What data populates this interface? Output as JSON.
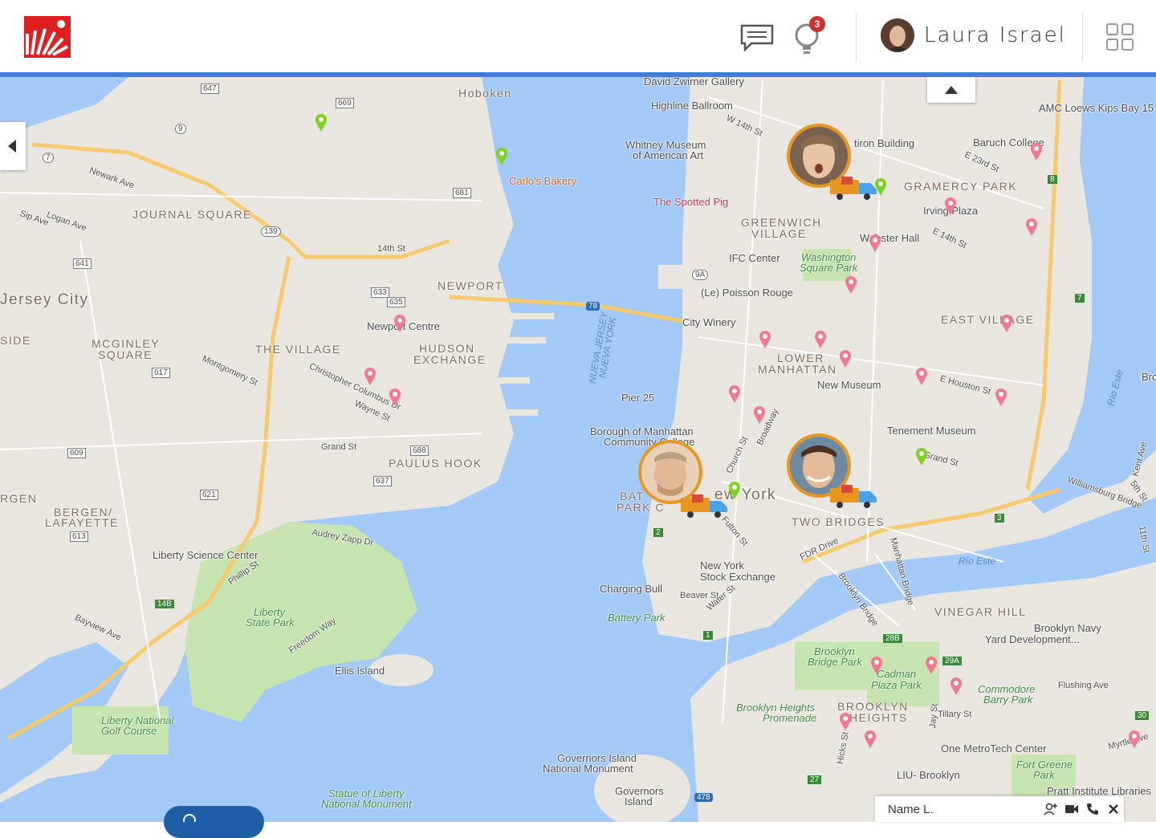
{
  "header": {
    "notifications_count": "3",
    "user_name": "Laura Israel",
    "brand_color": "#e02020",
    "accent_color": "#3f7fd8"
  },
  "map": {
    "neighborhoods": [
      "JOURNAL SQUARE",
      "Jersey City",
      "MCGINLEY",
      "SQUARE",
      "THE VILLAGE",
      "NEWPORT",
      "HUDSON",
      "EXCHANGE",
      "PAULUS HOOK",
      "BERGEN/",
      "LAFAYETTE",
      "GREENWICH",
      "VILLAGE",
      "GRAMERCY PARK",
      "EAST VILLAGE",
      "LOWER",
      "MANHATTAN",
      "TWO BRIDGES",
      "VINEGAR HILL",
      "BROOKLYN",
      "HEIGHTS",
      "SIDE",
      "RGEN",
      "Hoboken",
      "Bro"
    ],
    "places": [
      "David Zwirner Gallery",
      "Highline Ballroom",
      "Whitney Museum",
      "of American Art",
      "Carlo's Bakery",
      "The Spotted Pig",
      "IFC Center",
      "(Le) Poisson Rouge",
      "City Winery",
      "Pier 25",
      "Borough of Manhattan",
      "Community College",
      "New Museum",
      "Tenement Museum",
      "Liberty Science Center",
      "Newport Centre",
      "Ellis Island",
      "Charging Bull",
      "New York",
      "Stock Exchange",
      "Governors Island",
      "National Monument",
      "Governors",
      "Island",
      "One MetroTech Center",
      "LIU- Brooklyn",
      "Pratt Institute Libraries",
      "Brooklyn Navy",
      "Yard Development...",
      "Baruch College",
      "AMC Loews Kips Bay 15",
      "tiron Building",
      "Irving Plaza",
      "Webster Hall",
      "BAT",
      "PARK C",
      "ew York"
    ],
    "parks": [
      "Liberty",
      "State Park",
      "Liberty National",
      "Golf Course",
      "Washington",
      "Square Park",
      "Battery Park",
      "Statue of Liberty",
      "National Monument",
      "Brooklyn",
      "Bridge Park",
      "Cadman",
      "Plaza Park",
      "Brooklyn Heights",
      "Promenade",
      "Commodore",
      "Barry Park",
      "Fort Greene",
      "Park"
    ],
    "water": [
      "Río Este",
      "NUEVA JERSEY",
      "NUEVA YORK",
      "Río Este"
    ],
    "streets": [
      "Newark Ave",
      "Sip Ave",
      "Logan Ave",
      "14th St",
      "Grand St",
      "Montgomery St",
      "Christopher Columbus Dr",
      "Wayne St",
      "Audrey Zapp Dr",
      "Bayview Ave",
      "Phillip St",
      "Freedom Way",
      "FDR Drive",
      "Brooklyn Bridge",
      "Manhattan Bridge",
      "Williamsburg Bridge",
      "Grand St",
      "E Houston St",
      "Flushing Ave",
      "Tillary St",
      "W 14th St",
      "E 23rd St",
      "E 14th St",
      "Broadway",
      "Church St",
      "Fulton St",
      "Beaver St",
      "Water St",
      "Myrtle Ave",
      "5th St",
      "11th St",
      "Kent Ave",
      "Hicks St",
      "Jay St"
    ],
    "routes": [
      "647",
      "669",
      "681",
      "641",
      "139",
      "617",
      "633",
      "635",
      "609",
      "621",
      "613",
      "637",
      "688",
      "9",
      "7",
      "78",
      "14B",
      "1",
      "2",
      "3",
      "7",
      "8",
      "9A",
      "28B",
      "29A",
      "30",
      "27",
      "478"
    ]
  },
  "chat": {
    "name": "Name L."
  }
}
